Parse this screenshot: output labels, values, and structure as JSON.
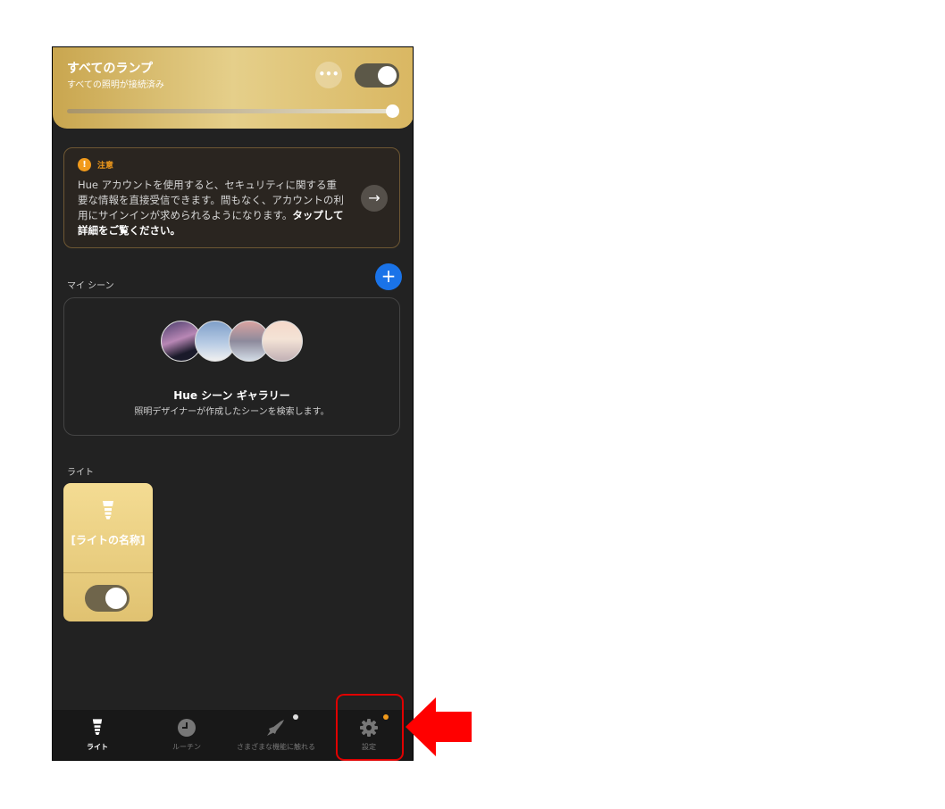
{
  "header": {
    "title": "すべてのランプ",
    "subtitle": "すべての照明が接続済み",
    "more_icon": "ellipsis-icon",
    "brightness_percent": 100,
    "power_on": true
  },
  "notice": {
    "icon": "exclamation-icon",
    "title": "注意",
    "body": "Hue アカウントを使用すると、セキュリティに関する重要な情報を直接受信できます。間もなく、アカウントの利用にサインインが求められるようになります。",
    "emphasis": "タップして詳細をご覧ください。",
    "arrow_icon": "arrow-right-icon"
  },
  "scenes": {
    "section_label": "マイ シーン",
    "add_icon": "plus-icon",
    "gallery_title": "Hue シーン ギャラリー",
    "gallery_subtitle": "照明デザイナーが作成したシーンを検索します。"
  },
  "lights": {
    "section_label": "ライト",
    "items": [
      {
        "name": "[ライトの名称]",
        "icon": "bulb-icon",
        "on": true
      }
    ]
  },
  "nav": {
    "items": [
      {
        "label": "ライト",
        "icon": "bulb-icon",
        "active": true
      },
      {
        "label": "ルーチン",
        "icon": "clock-icon",
        "active": false
      },
      {
        "label": "さまざまな機能に触れる",
        "icon": "rocket-icon",
        "active": false
      },
      {
        "label": "設定",
        "icon": "gear-icon",
        "active": false
      }
    ]
  },
  "colors": {
    "accent_gold": "#d9b762",
    "notice_orange": "#f19a1b",
    "add_blue": "#1a73e8",
    "highlight_red": "#e00000"
  }
}
